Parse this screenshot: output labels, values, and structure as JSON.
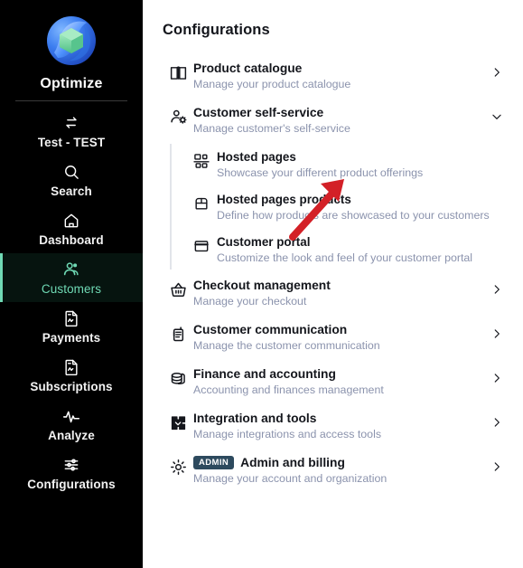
{
  "sidebar": {
    "brand_name": "Optimize",
    "logo_icon": "optimize-sphere-cube-logo",
    "items": [
      {
        "label": "Test - TEST",
        "icon": "swap-arrows-icon",
        "active": false
      },
      {
        "label": "Search",
        "icon": "search-icon",
        "active": false
      },
      {
        "label": "Dashboard",
        "icon": "home-icon",
        "active": false
      },
      {
        "label": "Customers",
        "icon": "users-icon",
        "active": true
      },
      {
        "label": "Payments",
        "icon": "document-icon",
        "active": false
      },
      {
        "label": "Subscriptions",
        "icon": "document-icon",
        "active": false
      },
      {
        "label": "Analyze",
        "icon": "pulse-icon",
        "active": false
      },
      {
        "label": "Configurations",
        "icon": "sliders-icon",
        "active": false
      }
    ],
    "active_color": "#6fd9b4",
    "background": "#000000"
  },
  "main": {
    "page_title": "Configurations",
    "rows": [
      {
        "title": "Product catalogue",
        "subtitle": "Manage your product catalogue",
        "icon": "book-icon",
        "chevron": "chevron-right",
        "badge": null
      },
      {
        "title": "Customer self-service",
        "subtitle": "Manage customer's self-service",
        "icon": "user-gear-icon",
        "chevron": "chevron-down",
        "badge": null
      },
      {
        "title": "Checkout management",
        "subtitle": "Manage your checkout",
        "icon": "basket-icon",
        "chevron": "chevron-right",
        "badge": null
      },
      {
        "title": "Customer communication",
        "subtitle": "Manage the customer communication",
        "icon": "radio-icon",
        "chevron": "chevron-right",
        "badge": null
      },
      {
        "title": "Finance and accounting",
        "subtitle": "Accounting and finances management",
        "icon": "coins-icon",
        "chevron": "chevron-right",
        "badge": null
      },
      {
        "title": "Integration and tools",
        "subtitle": "Manage integrations and access tools",
        "icon": "puzzle-icon",
        "chevron": "chevron-right",
        "badge": null
      },
      {
        "title": "Admin and billing",
        "subtitle": "Manage your account and organization",
        "icon": "gear-icon",
        "chevron": "chevron-right",
        "badge": "ADMIN"
      }
    ],
    "subitems": [
      {
        "title": "Hosted pages",
        "subtitle": "Showcase your different product offerings",
        "icon": "layout-blocks-icon"
      },
      {
        "title": "Hosted pages products",
        "subtitle": "Define how products are showcased to your customers",
        "icon": "box-icon"
      },
      {
        "title": "Customer portal",
        "subtitle": "Customize the look and feel of your customer portal",
        "icon": "window-icon"
      }
    ],
    "annotation": {
      "icon": "red-arrow-pointer",
      "color": "#d32027"
    },
    "subtitle_color": "#8b93ad",
    "badge_color": "#2d4a5e"
  }
}
